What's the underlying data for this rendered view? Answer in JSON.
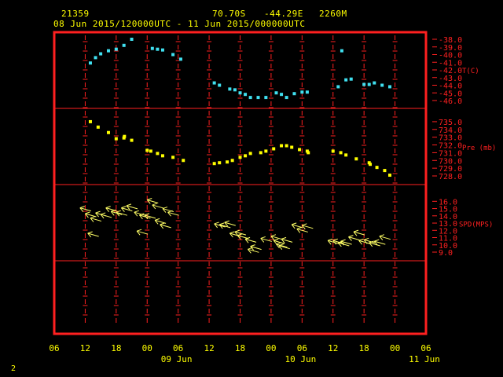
{
  "header": {
    "station": "21359",
    "latitude": "70.70S",
    "longitude": "-44.29E",
    "elevation": "2260M",
    "period": "08 Jun 2015/120000UTC - 11 Jun 2015/000000UTC"
  },
  "footnote": "2",
  "colors": {
    "frame": "#ff2020",
    "axis_text": "#ff2020",
    "grid": "#ff2020",
    "date_text": "#ffff00",
    "temperature": "#40e0f0",
    "pressure": "#ffff00",
    "wind": "#ffff66"
  },
  "chart_data": {
    "type": "scatter",
    "x_axis": {
      "tick_labels": [
        "06",
        "12",
        "18",
        "00",
        "06",
        "12",
        "18",
        "00",
        "06",
        "12",
        "18",
        "00",
        "06"
      ],
      "day_labels": [
        {
          "label": "09 Jun",
          "at_hour": 24
        },
        {
          "label": "10 Jun",
          "at_hour": 48
        },
        {
          "label": "11 Jun",
          "at_hour": 72
        }
      ],
      "start": "2015-06-08 06UTC",
      "end": "2015-06-11 06UTC",
      "range_hours": [
        0,
        72
      ],
      "grid": true
    },
    "panels": [
      {
        "name": "temperature",
        "label": "T(C)",
        "ticks": [
          "-38.0",
          "-39.0",
          "-40.0",
          "-41.0",
          "-42.0",
          "-43.0",
          "-44.0",
          "-45.0",
          "-46.0"
        ],
        "ylim": [
          -46,
          -38
        ],
        "points": [
          [
            7,
            -41.1
          ],
          [
            8,
            -40.4
          ],
          [
            9,
            -39.9
          ],
          [
            10.5,
            -39.5
          ],
          [
            12,
            -39.3
          ],
          [
            13.5,
            -38.8
          ],
          [
            15,
            -38.0
          ],
          [
            19,
            -39.2
          ],
          [
            20,
            -39.3
          ],
          [
            21,
            -39.4
          ],
          [
            23,
            -40.0
          ],
          [
            24.5,
            -40.6
          ],
          [
            31,
            -43.7
          ],
          [
            32,
            -44.0
          ],
          [
            34,
            -44.5
          ],
          [
            35,
            -44.6
          ],
          [
            36,
            -45.0
          ],
          [
            37,
            -45.2
          ],
          [
            38,
            -45.6
          ],
          [
            39.5,
            -45.6
          ],
          [
            41,
            -45.6
          ],
          [
            43,
            -45.0
          ],
          [
            44,
            -45.2
          ],
          [
            45,
            -45.6
          ],
          [
            46.5,
            -45.1
          ],
          [
            48,
            -44.9
          ],
          [
            49,
            -44.9
          ],
          [
            55,
            -44.2
          ],
          [
            55.7,
            -39.5
          ],
          [
            56.5,
            -43.3
          ],
          [
            57.5,
            -43.2
          ],
          [
            60,
            -43.9
          ],
          [
            61,
            -43.9
          ],
          [
            62,
            -43.7
          ],
          [
            63.5,
            -44.0
          ],
          [
            65,
            -44.2
          ]
        ]
      },
      {
        "name": "pressure",
        "label": "Pre (mb)",
        "ticks": [
          "735.0",
          "734.0",
          "733.0",
          "732.0",
          "731.0",
          "730.0",
          "729.0",
          "728.0"
        ],
        "ylim": [
          728,
          735.5
        ],
        "points": [
          [
            7,
            735.0
          ],
          [
            8.5,
            734.3
          ],
          [
            10.5,
            733.6
          ],
          [
            12,
            732.8
          ],
          [
            13.5,
            732.9
          ],
          [
            13.6,
            733.1
          ],
          [
            15,
            732.6
          ],
          [
            18,
            731.3
          ],
          [
            18.7,
            731.2
          ],
          [
            20,
            730.9
          ],
          [
            21,
            730.6
          ],
          [
            23,
            730.4
          ],
          [
            25,
            730.0
          ],
          [
            31,
            729.6
          ],
          [
            32,
            729.7
          ],
          [
            33.5,
            729.8
          ],
          [
            34.5,
            730.0
          ],
          [
            36,
            730.4
          ],
          [
            37,
            730.6
          ],
          [
            38,
            730.9
          ],
          [
            40,
            731.0
          ],
          [
            41,
            731.2
          ],
          [
            42.5,
            731.5
          ],
          [
            44,
            731.9
          ],
          [
            45,
            731.9
          ],
          [
            46,
            731.7
          ],
          [
            47.5,
            731.4
          ],
          [
            49,
            731.2
          ],
          [
            49.2,
            731.0
          ],
          [
            54,
            731.2
          ],
          [
            55.5,
            731.0
          ],
          [
            56.5,
            730.7
          ],
          [
            58.5,
            730.2
          ],
          [
            61,
            729.7
          ],
          [
            61.2,
            729.5
          ],
          [
            62.5,
            729.1
          ],
          [
            64,
            728.7
          ],
          [
            65,
            728.1
          ]
        ]
      },
      {
        "name": "wind",
        "label": "SPD(MPS)",
        "ticks": [
          "16.0",
          "15.0",
          "14.0",
          "13.0",
          "12.0",
          "11.0",
          "10.0",
          "9.0"
        ],
        "ylim": [
          9,
          16.9
        ],
        "points": [
          [
            5,
            15.1
          ],
          [
            6,
            14.3
          ],
          [
            7,
            13.7
          ],
          [
            8,
            14.4
          ],
          [
            9,
            14.2
          ],
          [
            10,
            15.1
          ],
          [
            11,
            14.6
          ],
          [
            12,
            14.5
          ],
          [
            13,
            15.1
          ],
          [
            14,
            15.4
          ],
          [
            16,
            11.9
          ],
          [
            15.5,
            14.5
          ],
          [
            16.5,
            14.1
          ],
          [
            18,
            16.2
          ],
          [
            19,
            15.5
          ],
          [
            17.5,
            14.1
          ],
          [
            19.5,
            13.4
          ],
          [
            20.5,
            12.8
          ],
          [
            21,
            15.0
          ],
          [
            22,
            14.5
          ],
          [
            6.5,
            11.6
          ],
          [
            31,
            12.9
          ],
          [
            32,
            12.8
          ],
          [
            33,
            13.1
          ],
          [
            34,
            11.6
          ],
          [
            35,
            11.8
          ],
          [
            35.5,
            11.3
          ],
          [
            37,
            10.8
          ],
          [
            37.5,
            9.4
          ],
          [
            38,
            9.8
          ],
          [
            40,
            10.9
          ],
          [
            42,
            11.2
          ],
          [
            42.5,
            10.6
          ],
          [
            43,
            10.1
          ],
          [
            43.5,
            9.9
          ],
          [
            44,
            10.8
          ],
          [
            46,
            12.8
          ],
          [
            47,
            12.2
          ],
          [
            48,
            12.7
          ],
          [
            53,
            10.6
          ],
          [
            54,
            10.6
          ],
          [
            55,
            10.3
          ],
          [
            55.5,
            10.5
          ],
          [
            57,
            11.1
          ],
          [
            58,
            11.8
          ],
          [
            59,
            10.6
          ],
          [
            60,
            10.7
          ],
          [
            61,
            10.3
          ],
          [
            62,
            10.5
          ],
          [
            63,
            11.2
          ]
        ]
      }
    ]
  }
}
